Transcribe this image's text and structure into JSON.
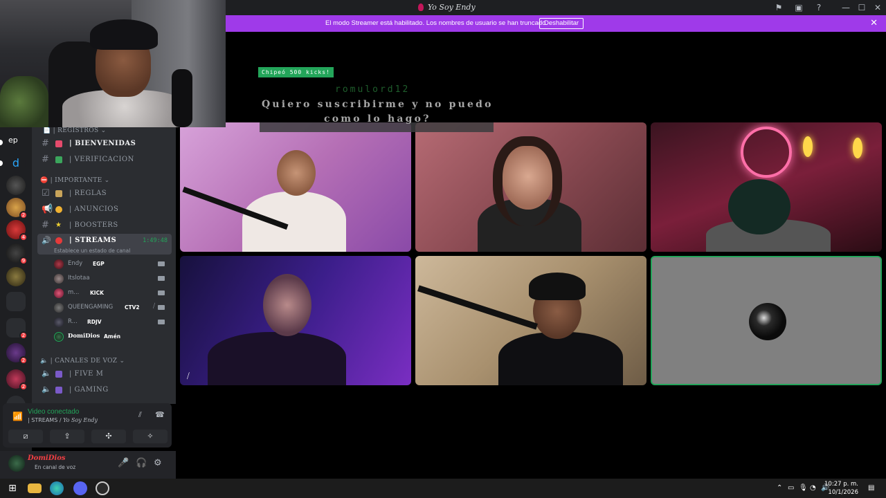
{
  "window": {
    "title": "Yo Soy Endy"
  },
  "banner": {
    "message": "El modo Streamer está habilitado. Los nombres de usuario se han truncado.",
    "button": "Deshabilitar"
  },
  "chat_overlay": {
    "banner": "Chipeó 500 kicks!",
    "user": "romulord12",
    "line1": "Quiero suscribirme y no puedo",
    "line2": "como lo hago?"
  },
  "servers": {
    "top_label": "ep"
  },
  "channels": {
    "categories": {
      "registros": "| REGISTROS",
      "importante": "| IMPORTANTE",
      "voz": "| CANALES DE VOZ"
    },
    "text": [
      {
        "label": "| BIENVENIDAS"
      },
      {
        "label": "| VERIFICACION"
      },
      {
        "label": "| REGLAS"
      },
      {
        "label": "| ANUNCIOS"
      },
      {
        "label": "| BOOSTERS"
      }
    ],
    "streams": {
      "label": "| STREAMS",
      "timer": "1:49:48",
      "status": "Establece un estado de canal"
    },
    "voice_users": [
      {
        "name": "Endy",
        "tag": "EGP"
      },
      {
        "name": "Itslotaa",
        "tag": ""
      },
      {
        "name": "m...",
        "tag": "KICK"
      },
      {
        "name": "QUEENGAMING",
        "tag": "CTV2"
      },
      {
        "name": "R...",
        "tag": "RDJV"
      },
      {
        "name": "DomiDios",
        "tag": "Amén"
      }
    ],
    "voice_channels": [
      {
        "label": "| FIVE M"
      },
      {
        "label": "| GAMING"
      }
    ]
  },
  "voice_panel": {
    "status": "Video conectado",
    "channel": "| STREAMS",
    "server": "Yo Soy Endy"
  },
  "user_panel": {
    "username": "DomiDios",
    "status": "En canal de voz"
  },
  "taskbar": {
    "time": "10:27 p. m.",
    "date": "10/1/2026"
  },
  "colors": {
    "banner": "#9f3ae9",
    "live": "#23a55a",
    "danger": "#f23f43",
    "sidebar": "#2b2d31"
  }
}
